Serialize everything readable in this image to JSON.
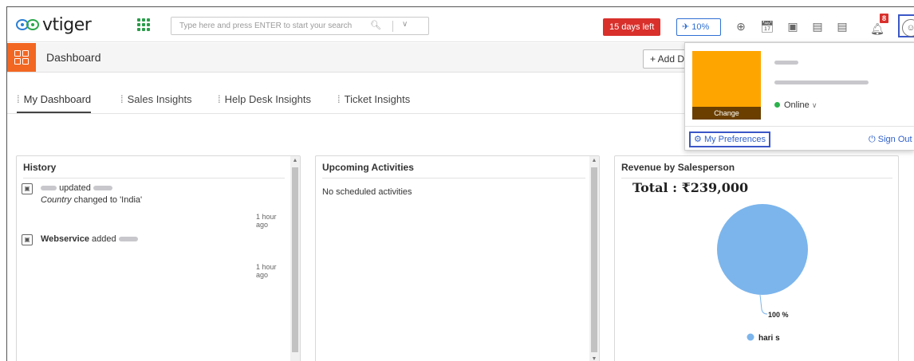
{
  "header": {
    "logo_text": "vtiger",
    "search_placeholder": "Type here and press ENTER to start your search",
    "trial_label": "15 days left",
    "progress_label": "10%",
    "notification_count": "8"
  },
  "subheader": {
    "title": "Dashboard",
    "add_button": "+ Add D"
  },
  "tabs": [
    {
      "label": "My Dashboard",
      "active": true
    },
    {
      "label": "Sales Insights",
      "active": false
    },
    {
      "label": "Help Desk Insights",
      "active": false
    },
    {
      "label": "Ticket Insights",
      "active": false
    }
  ],
  "history": {
    "title": "History",
    "items": [
      {
        "action": "updated",
        "detail_field": "Country",
        "detail_text": "changed to 'India'",
        "time": "1 hour ago"
      },
      {
        "actor": "Webservice",
        "action": "added",
        "time": "1 hour ago"
      }
    ]
  },
  "upcoming": {
    "title": "Upcoming Activities",
    "empty_text": "No scheduled activities"
  },
  "revenue": {
    "title": "Revenue by Salesperson",
    "total": "Total : ₹239,000",
    "slice_label": "100 %",
    "legend_label": "hari s"
  },
  "chart_data": {
    "type": "pie",
    "title": "Total : ₹239,000",
    "categories": [
      "hari s"
    ],
    "values": [
      100
    ],
    "legend": "bottom",
    "colors": [
      "#7cb5ec"
    ]
  },
  "profile_popup": {
    "change_label": "Change",
    "status": "Online",
    "preferences_label": "My Preferences",
    "signout_label": "Sign Out"
  },
  "colors": {
    "accent_orange": "#f26722",
    "trial_red": "#d9302c",
    "link_blue": "#2f5fc9",
    "avatar": "#ffa500",
    "pie": "#7cb5ec"
  }
}
